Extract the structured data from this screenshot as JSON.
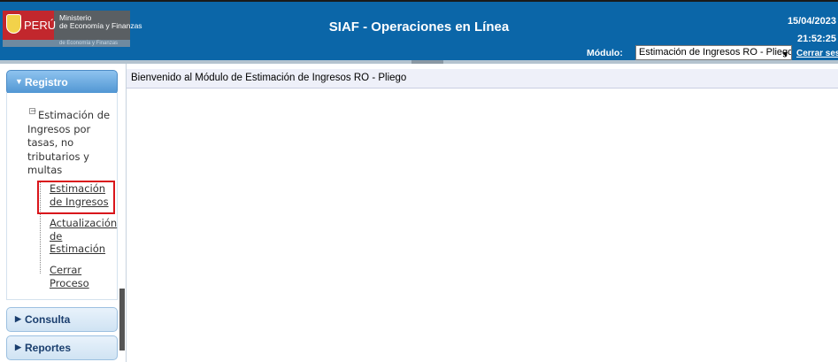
{
  "header": {
    "logo": {
      "country": "PERÚ",
      "ministry_line1": "Ministerio",
      "ministry_line2": "de Economía y Finanzas",
      "strip_text": "de Economía y Finanzas"
    },
    "title": "SIAF - Operaciones en Línea",
    "date": "15/04/2023",
    "time": "21:52:25",
    "modulo_label": "Módulo:",
    "modulo_value": "Estimación de Ingresos RO - Pliego",
    "cerrar_sesion": "Cerrar sesió"
  },
  "sidebar": {
    "sections": [
      {
        "label": "Registro",
        "expanded": true
      },
      {
        "label": "Consulta",
        "expanded": false
      },
      {
        "label": "Reportes",
        "expanded": false
      }
    ],
    "tree": {
      "parent_label": "Estimación de Ingresos por tasas, no tributarios y multas",
      "items": [
        {
          "label": "Estimación de Ingresos",
          "highlighted": true
        },
        {
          "label": "Actualización de Estimación"
        },
        {
          "label": "Cerrar Proceso"
        }
      ]
    }
  },
  "main": {
    "title": "Bienvenido al Módulo de Estimación de Ingresos RO - Pliego"
  },
  "colors": {
    "header_blue": "#0b66a8",
    "highlight_red": "#d9151b",
    "accordion_active": "#4f95d2"
  }
}
